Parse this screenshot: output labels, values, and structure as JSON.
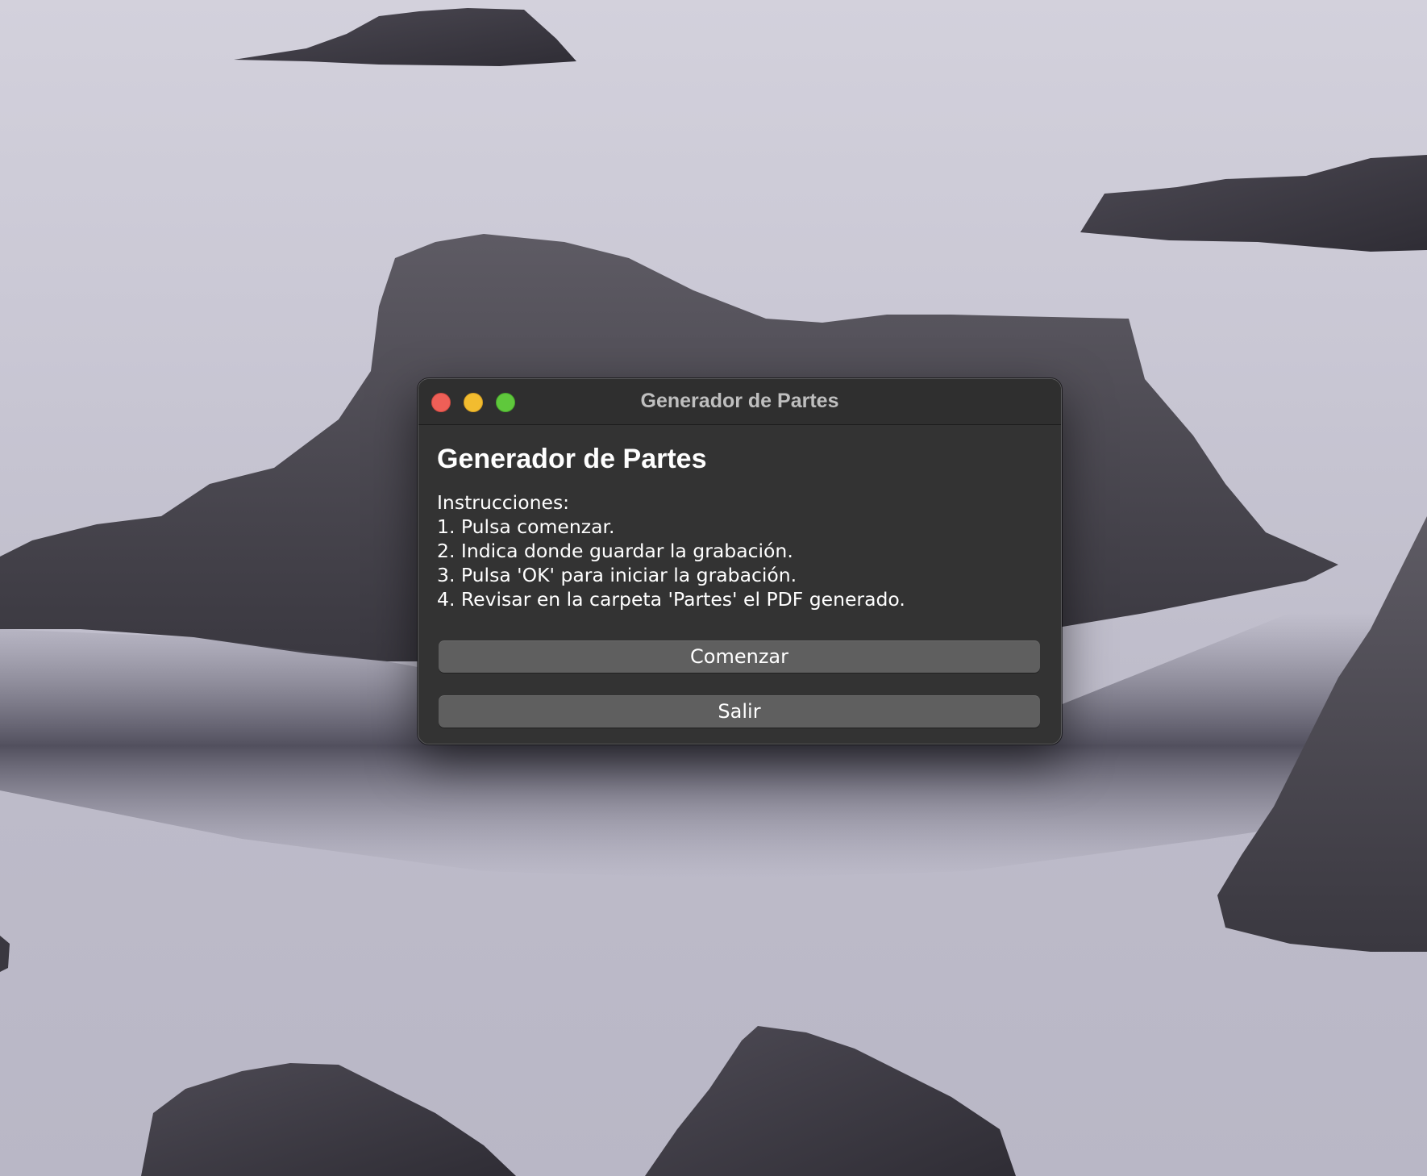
{
  "window": {
    "title": "Generador de Partes"
  },
  "main": {
    "heading": "Generador de Partes",
    "instructions_label": "Instrucciones:",
    "steps": [
      "1. Pulsa comenzar.",
      "2. Indica donde guardar la grabación.",
      "3. Pulsa 'OK' para iniciar la grabación.",
      "4. Revisar en la carpeta 'Partes' el PDF generado."
    ]
  },
  "buttons": {
    "start_label": "Comenzar",
    "quit_label": "Salir"
  },
  "colors": {
    "window_bg": "#333333",
    "button_bg": "#5f5f5f",
    "close": "#ee5f57",
    "minimize": "#f2bc2f",
    "maximize": "#5fc83c"
  }
}
